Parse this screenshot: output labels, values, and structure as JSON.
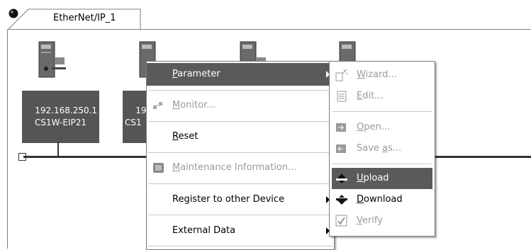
{
  "tab": {
    "label": "EtherNet/IP_1"
  },
  "devices": [
    {
      "ip": "192.168.250.1",
      "model": "CS1W-EIP21"
    },
    {
      "ip": "192.",
      "model": "CS1"
    }
  ],
  "context_menu": {
    "items": [
      {
        "label": "Parameter",
        "mnemonic": "P",
        "rest": "arameter"
      },
      {
        "label": "Monitor...",
        "mnemonic": "M",
        "rest": "onitor..."
      },
      {
        "label": "Reset",
        "mnemonic": "R",
        "rest": "eset"
      },
      {
        "label": "Maintenance Information...",
        "mnemonic": "M",
        "rest": "aintenance Information..."
      },
      {
        "label": "Register to other Device"
      },
      {
        "label": "External Data"
      }
    ]
  },
  "submenu": {
    "items": [
      {
        "label": "Wizard...",
        "mnemonic": "W",
        "rest": "izard..."
      },
      {
        "label": "Edit...",
        "mnemonic": "E",
        "rest": "dit..."
      },
      {
        "label": "Open...",
        "mnemonic": "O",
        "rest": "pen..."
      },
      {
        "label": "Save as...",
        "pre": "Save ",
        "mnemonic": "a",
        "rest": "s..."
      },
      {
        "label": "Upload",
        "mnemonic": "U",
        "rest": "pload"
      },
      {
        "label": "Download",
        "mnemonic": "D",
        "rest": "ownload"
      },
      {
        "label": "Verify",
        "mnemonic": "V",
        "rest": "erify"
      }
    ]
  },
  "colors": {
    "highlight": "#5a5a5a",
    "disabled": "#9a9a9a",
    "label_bg": "#555555"
  }
}
